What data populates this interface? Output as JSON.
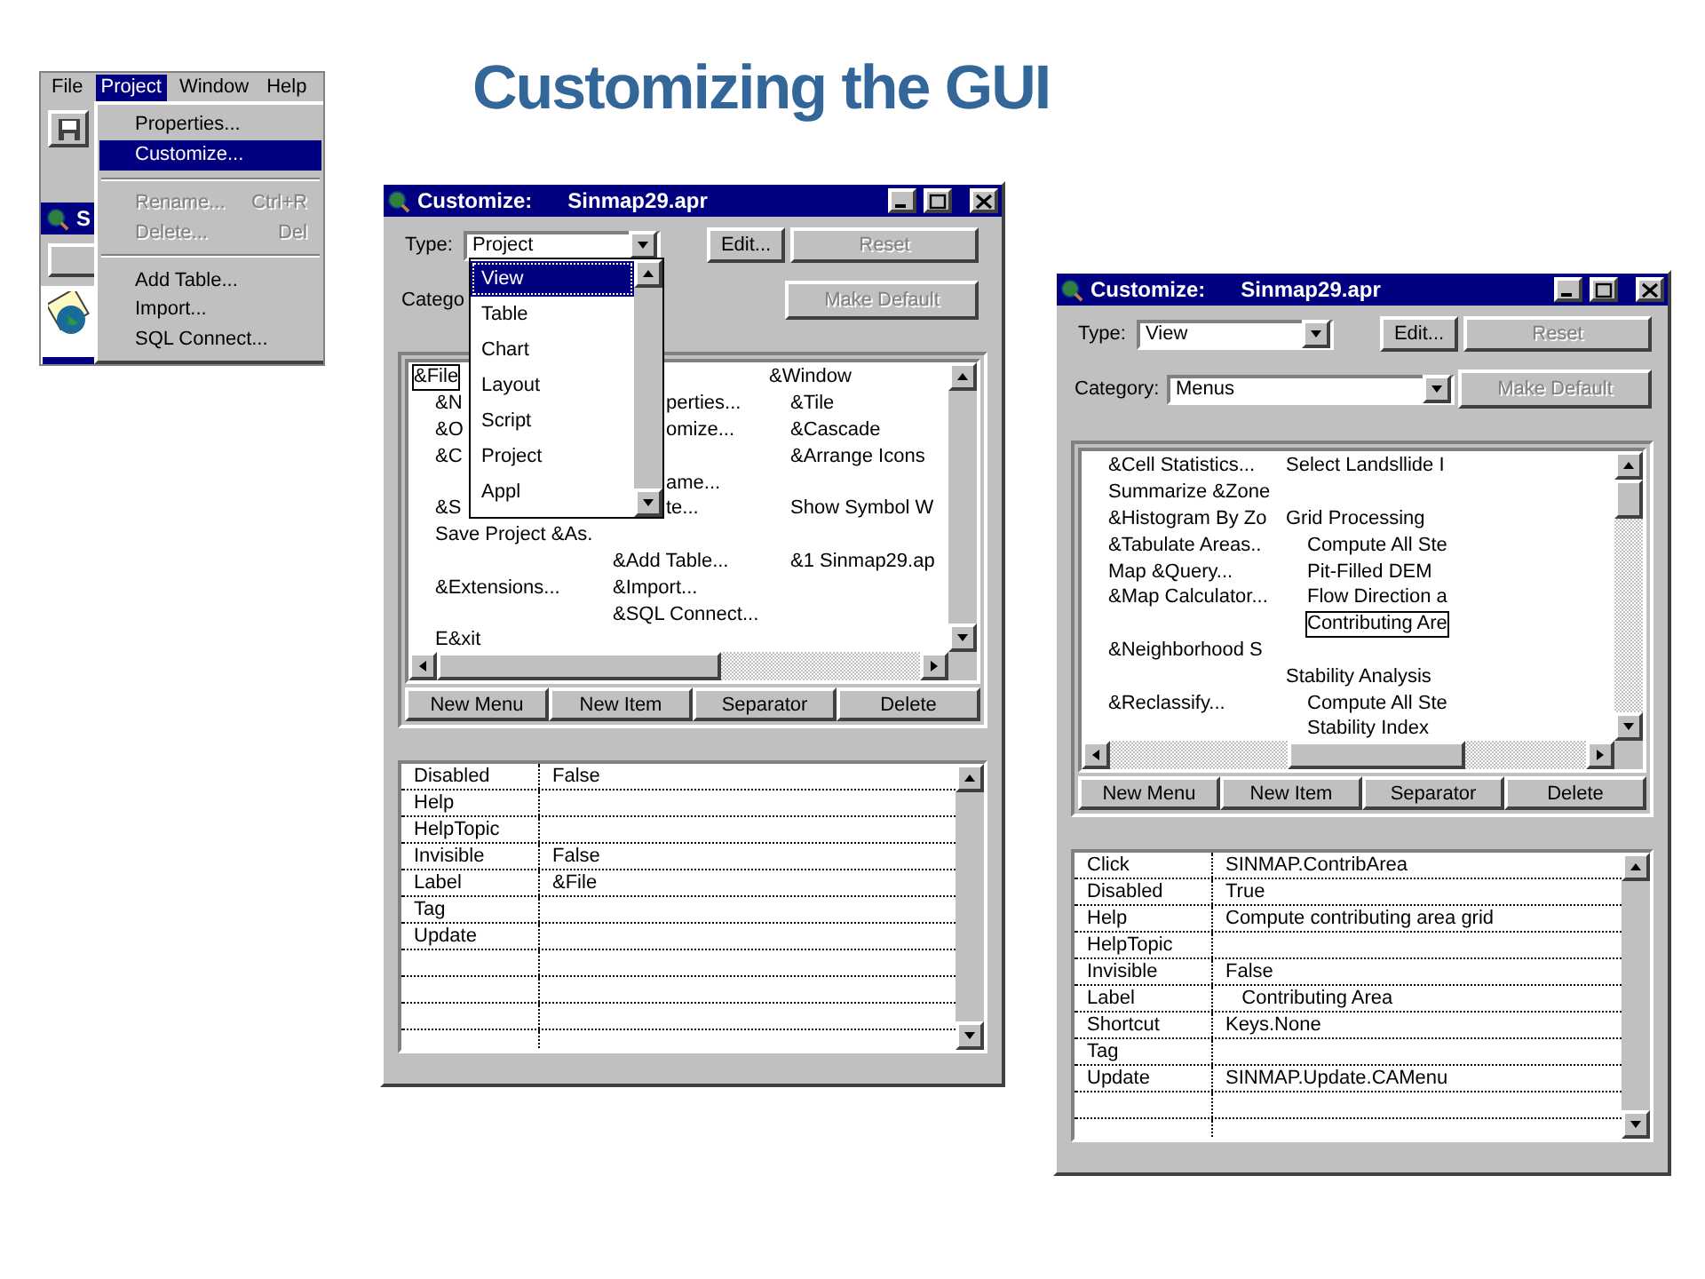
{
  "title": "Customizing the GUI",
  "app_fragment": {
    "menu_bar": [
      {
        "label": "File",
        "selected": false
      },
      {
        "label": "Project",
        "selected": true
      },
      {
        "label": "Window",
        "selected": false
      },
      {
        "label": "Help",
        "selected": false
      }
    ],
    "window_title": "S",
    "project_menu": [
      {
        "kind": "item",
        "label": "Properties...",
        "selected": false,
        "disabled": false
      },
      {
        "kind": "item",
        "label": "Customize...",
        "selected": true,
        "disabled": false
      },
      {
        "kind": "separator"
      },
      {
        "kind": "item",
        "label": "Rename...",
        "shortcut": "Ctrl+R",
        "selected": false,
        "disabled": true
      },
      {
        "kind": "item",
        "label": "Delete...",
        "shortcut": "Del",
        "selected": false,
        "disabled": true
      },
      {
        "kind": "separator"
      },
      {
        "kind": "item",
        "label": "Add Table...",
        "selected": false,
        "disabled": false
      },
      {
        "kind": "item",
        "label": "Import...",
        "selected": false,
        "disabled": false
      },
      {
        "kind": "item",
        "label": "SQL Connect...",
        "selected": false,
        "disabled": false
      }
    ]
  },
  "dialogs": [
    {
      "title": "Customize:",
      "file": "Sinmap29.apr",
      "type_label": "Type:",
      "type_value": "Project",
      "category_label": "Catego",
      "edit_button": "Edit...",
      "reset_button": {
        "label": "Reset",
        "disabled": true
      },
      "make_default_button": {
        "label": "Make Default",
        "disabled": true
      },
      "type_dropdown": [
        {
          "label": "View",
          "selected": true
        },
        {
          "label": "Table",
          "selected": false
        },
        {
          "label": "Chart",
          "selected": false
        },
        {
          "label": "Layout",
          "selected": false
        },
        {
          "label": "Script",
          "selected": false
        },
        {
          "label": "Project",
          "selected": false
        },
        {
          "label": "Appl",
          "selected": false
        }
      ],
      "menu_rows": [
        {
          "column_1": {
            "text": "&File",
            "kind": "menu",
            "selected": true
          },
          "column_3": {
            "text": "&Window",
            "kind": "menu",
            "selected": false
          }
        },
        {
          "column_1": {
            "text": "&N",
            "kind": "item",
            "selected": false
          },
          "column_2": {
            "text": "perties...",
            "kind": "partial",
            "selected": false
          },
          "column_3": {
            "text": "&Tile",
            "kind": "item",
            "selected": false
          }
        },
        {
          "column_1": {
            "text": "&O",
            "kind": "item",
            "selected": false
          },
          "column_2": {
            "text": "omize...",
            "kind": "partial",
            "selected": false
          },
          "column_3": {
            "text": "&Cascade",
            "kind": "item",
            "selected": false
          }
        },
        {
          "column_1": {
            "text": "&C",
            "kind": "item",
            "selected": false
          },
          "column_3": {
            "text": "&Arrange Icons",
            "kind": "item",
            "selected": false
          }
        },
        {
          "column_2": {
            "text": "ame...",
            "kind": "partial",
            "selected": false
          }
        },
        {
          "column_1": {
            "text": "&S",
            "kind": "item",
            "selected": false
          },
          "column_2": {
            "text": "te...",
            "kind": "partial",
            "selected": false
          },
          "column_3": {
            "text": "Show Symbol W",
            "kind": "item",
            "selected": false
          }
        },
        {
          "column_1": {
            "text": "Save Project &As.",
            "kind": "item",
            "selected": false
          }
        },
        {
          "column_2": {
            "text": "&Add Table...",
            "kind": "item",
            "selected": false
          },
          "column_3": {
            "text": "&1 Sinmap29.ap",
            "kind": "item",
            "selected": false
          }
        },
        {
          "column_1": {
            "text": "&Extensions...",
            "kind": "item",
            "selected": false
          },
          "column_2": {
            "text": "&Import...",
            "kind": "item",
            "selected": false
          }
        },
        {
          "column_2": {
            "text": "&SQL Connect...",
            "kind": "item",
            "selected": false
          }
        },
        {
          "column_1": {
            "text": "E&xit",
            "kind": "item",
            "selected": false
          }
        }
      ],
      "menu_buttons": [
        "New Menu",
        "New Item",
        "Separator",
        "Delete"
      ],
      "properties": [
        {
          "name": "Disabled",
          "value": "False"
        },
        {
          "name": "Help"
        },
        {
          "name": "HelpTopic"
        },
        {
          "name": "Invisible",
          "value": "False"
        },
        {
          "name": "Label",
          "value": "&File"
        },
        {
          "name": "Tag"
        },
        {
          "name": "Update"
        }
      ]
    },
    {
      "title": "Customize:",
      "file": "Sinmap29.apr",
      "type_label": "Type:",
      "type_value": "View",
      "category_label": "Category:",
      "category_value": "Menus",
      "edit_button": "Edit...",
      "reset_button": {
        "label": "Reset",
        "disabled": true
      },
      "make_default_button": {
        "label": "Make Default",
        "disabled": true
      },
      "menu_rows": [
        {
          "column_1": {
            "text": "&Cell Statistics...",
            "kind": "item",
            "selected": false
          },
          "column_2": {
            "text": "Select Landsllide I",
            "kind": "menu",
            "selected": false
          }
        },
        {
          "column_1": {
            "text": "Summarize &Zone",
            "kind": "item",
            "selected": false
          }
        },
        {
          "column_1": {
            "text": "&Histogram By Zo",
            "kind": "item",
            "selected": false
          },
          "column_2": {
            "text": "Grid Processing",
            "kind": "menu",
            "selected": false
          }
        },
        {
          "column_1": {
            "text": "&Tabulate Areas..",
            "kind": "item",
            "selected": false
          },
          "column_2": {
            "text": "Compute All Ste",
            "kind": "item",
            "selected": false
          }
        },
        {
          "column_1": {
            "text": "Map &Query...",
            "kind": "item",
            "selected": false
          },
          "column_2": {
            "text": "Pit-Filled DEM",
            "kind": "item",
            "selected": false
          }
        },
        {
          "column_1": {
            "text": "&Map Calculator...",
            "kind": "item",
            "selected": false
          },
          "column_2": {
            "text": "Flow Direction a",
            "kind": "item",
            "selected": false
          }
        },
        {
          "column_2": {
            "text": "Contributing Are",
            "kind": "item",
            "selected": true
          }
        },
        {
          "column_1": {
            "text": "&Neighborhood S",
            "kind": "item",
            "selected": false
          }
        },
        {
          "column_2": {
            "text": "Stability Analysis",
            "kind": "menu",
            "selected": false
          }
        },
        {
          "column_1": {
            "text": "&Reclassify...",
            "kind": "item",
            "selected": false
          },
          "column_2": {
            "text": "Compute All Ste",
            "kind": "item",
            "selected": false
          }
        },
        {
          "column_2": {
            "text": "Stability Index",
            "kind": "item",
            "selected": false
          }
        }
      ],
      "menu_buttons": [
        "New Menu",
        "New Item",
        "Separator",
        "Delete"
      ],
      "properties": [
        {
          "name": "Click",
          "value": "SINMAP.ContribArea"
        },
        {
          "name": "Disabled",
          "value": "True"
        },
        {
          "name": "Help",
          "value": "Compute contributing area grid"
        },
        {
          "name": "HelpTopic"
        },
        {
          "name": "Invisible",
          "value": "False"
        },
        {
          "name": "Label",
          "value": "   Contributing Area"
        },
        {
          "name": "Shortcut",
          "value": "Keys.None"
        },
        {
          "name": "Tag"
        },
        {
          "name": "Update",
          "value": "SINMAP.Update.CAMenu"
        }
      ]
    }
  ]
}
